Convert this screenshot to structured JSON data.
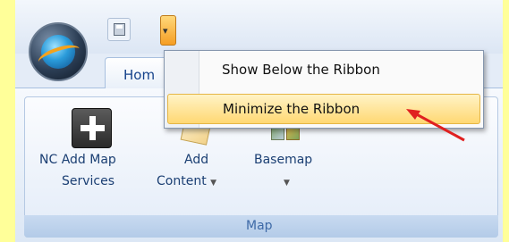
{
  "quick_access": {
    "save_icon": "save-icon",
    "customize_icon": "dropdown-arrow-icon"
  },
  "tabs": [
    {
      "label": "Hom",
      "active": true
    }
  ],
  "menu": {
    "items": [
      {
        "label": "Show Below the Ribbon",
        "highlighted": false
      },
      {
        "label": "Minimize the Ribbon",
        "highlighted": true
      }
    ]
  },
  "ribbon": {
    "group_label": "Map",
    "buttons": [
      {
        "label_line1": "NC Add Map",
        "label_line2": "Services",
        "icon": "plus-square-icon"
      },
      {
        "label_line1": "Add",
        "label_line2": "Content",
        "icon": "add-content-icon",
        "has_dropdown": true
      },
      {
        "label_line1": "Basemap",
        "label_line2": "",
        "icon": "basemap-icon",
        "has_dropdown": true
      }
    ]
  },
  "annotation": {
    "color": "#E02020",
    "target": "Minimize the Ribbon"
  },
  "colors": {
    "background": "#FFFF99",
    "accent": "#F5A623",
    "ribbon_text": "#1B3F73"
  }
}
